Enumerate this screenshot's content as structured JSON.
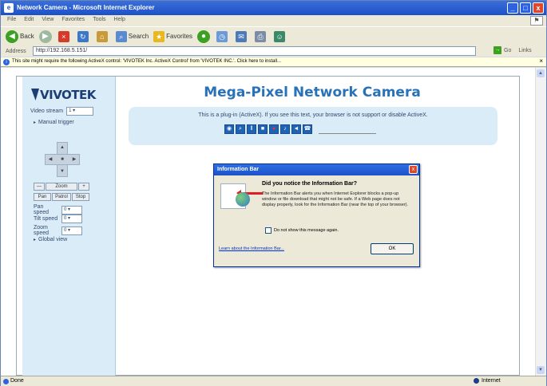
{
  "window": {
    "title": "Network Camera - Microsoft Internet Explorer",
    "minimize": "_",
    "maximize": "□",
    "close": "x"
  },
  "menu": [
    "File",
    "Edit",
    "View",
    "Favorites",
    "Tools",
    "Help"
  ],
  "toolbar": {
    "back": "Back",
    "search": "Search",
    "favorites": "Favorites"
  },
  "address": {
    "label": "Address",
    "value": "http://192.168.5.151/",
    "go": "Go",
    "links": "Links"
  },
  "infobar": {
    "text": "This site might require the following ActiveX control: 'VIVOTEK Inc. ActiveX Control' from 'VIVOTEK INC.'. Click here to install..."
  },
  "sidebar": {
    "logo": "VIVOTEK",
    "video_stream_label": "Video stream",
    "video_stream_value": "1",
    "manual_trigger": "Manual trigger",
    "pan_speed_label": "Pan speed",
    "pan_speed_value": "0",
    "tilt_speed_label": "Tilt speed",
    "tilt_speed_value": "0",
    "zoom_speed_label": "Zoom speed",
    "zoom_speed_value": "0",
    "global_view": "Global view",
    "zoom_buttons": [
      "—",
      "Zoom",
      "+"
    ],
    "focus_buttons": [
      "Pan",
      "Patrol",
      "Stop"
    ]
  },
  "main": {
    "title": "Mega-Pixel Network Camera",
    "plugin_message": "This is a plug-in (ActiveX). If you see this text, your browser is not support or disable ActiveX."
  },
  "dialog": {
    "title": "Information Bar",
    "close": "x",
    "heading": "Did you notice the Information Bar?",
    "body": "The Information Bar alerts you when Internet Explorer blocks a pop-up window or file download that might not be safe. If a Web page does not display properly, look for the Information Bar (near the top of your browser).",
    "checkbox_label": "Do not show this message again.",
    "link": "Learn about the Information Bar...",
    "ok": "OK"
  },
  "status": {
    "left": "Done",
    "zone": "Internet"
  }
}
